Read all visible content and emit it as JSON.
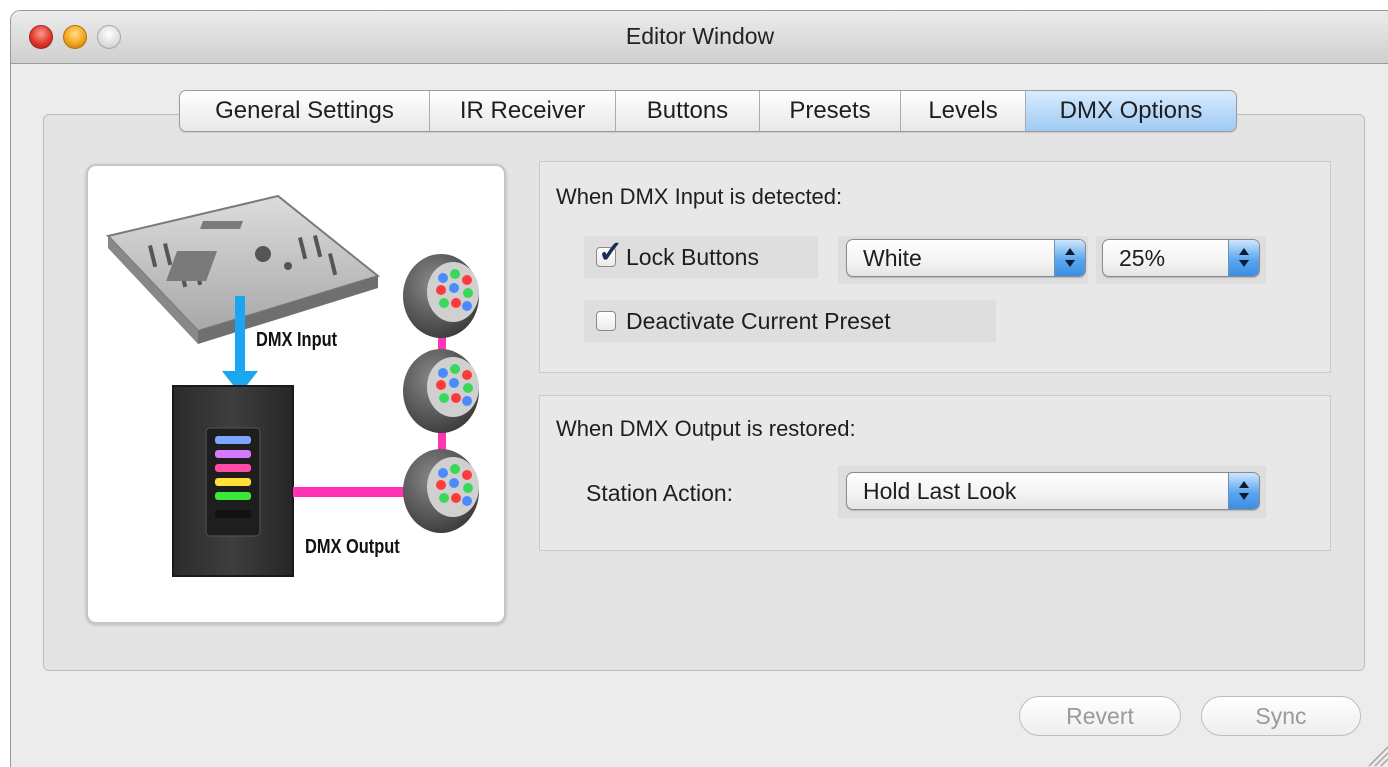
{
  "window": {
    "title": "Editor Window"
  },
  "tabs": [
    {
      "label": "General Settings",
      "active": false
    },
    {
      "label": "IR Receiver",
      "active": false
    },
    {
      "label": "Buttons",
      "active": false
    },
    {
      "label": "Presets",
      "active": false
    },
    {
      "label": "Levels",
      "active": false
    },
    {
      "label": "DMX Options",
      "active": true
    }
  ],
  "illustration": {
    "dmx_input_label": "DMX Input",
    "dmx_output_label": "DMX Output"
  },
  "input_group": {
    "title": "When DMX Input is detected:",
    "lock_buttons": {
      "label": "Lock Buttons",
      "checked": true
    },
    "color_popup": {
      "value": "White"
    },
    "level_popup": {
      "value": "25%"
    },
    "deactivate_preset": {
      "label": "Deactivate Current Preset",
      "checked": false
    }
  },
  "output_group": {
    "title": "When DMX Output is restored:",
    "station_action_label": "Station Action:",
    "station_action_popup": {
      "value": "Hold Last Look"
    }
  },
  "footer": {
    "revert_label": "Revert",
    "sync_label": "Sync"
  },
  "colors": {
    "arrow_input": "#1aa6f0",
    "arrow_output": "#ff33b5",
    "tab_active": "#9fcaf3"
  }
}
